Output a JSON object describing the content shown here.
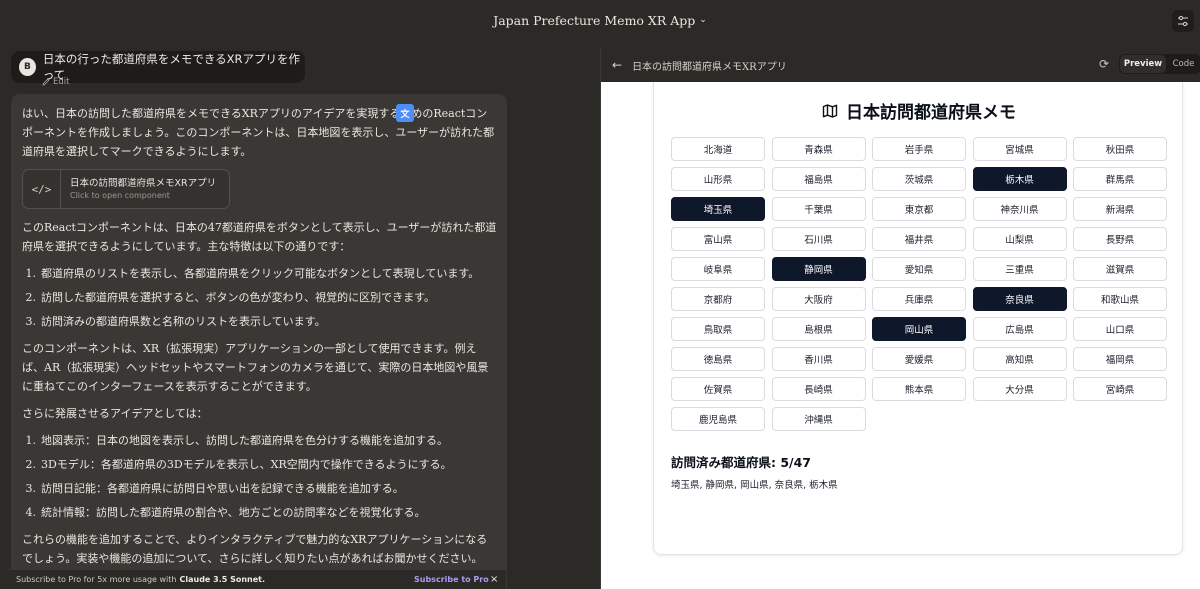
{
  "topbar": {
    "title": "Japan Prefecture Memo XR App",
    "chevron": "⌄"
  },
  "chat": {
    "user": {
      "initial": "B",
      "message": "日本の行った都道府県をメモできるXRアプリを作って",
      "edit_label": "Edit"
    },
    "assistant": {
      "intro": "はい、日本の訪問した都道府県をメモできるXRアプリのアイデアを実現するためのReactコンポーネントを作成しましょう。このコンポーネントは、日本地図を表示し、ユーザーが訪れた都道府県を選択してマークできるようにします。",
      "artifact": {
        "title": "日本の訪問都道府県メモXRアプリ",
        "subtitle": "Click to open component"
      },
      "para2": "このReactコンポーネントは、日本の47都道府県をボタンとして表示し、ユーザーが訪れた都道府県を選択できるようにしています。主な特徴は以下の通りです：",
      "features": [
        {
          "num": "1.",
          "text": "都道府県のリストを表示し、各都道府県をクリック可能なボタンとして表現しています。"
        },
        {
          "num": "2.",
          "text": "訪問した都道府県を選択すると、ボタンの色が変わり、視覚的に区別できます。"
        },
        {
          "num": "3.",
          "text": "訪問済みの都道府県数と名称のリストを表示しています。"
        }
      ],
      "para3": "このコンポーネントは、XR（拡張現実）アプリケーションの一部として使用できます。例えば、AR（拡張現実）ヘッドセットやスマートフォンのカメラを通じて、実際の日本地図や風景に重ねてこのインターフェースを表示することができます。",
      "para4": "さらに発展させるアイデアとしては：",
      "ideas": [
        {
          "num": "1.",
          "text": "地図表示：日本の地図を表示し、訪問した都道府県を色分けする機能を追加する。"
        },
        {
          "num": "2.",
          "text": "3Dモデル：各都道府県の3Dモデルを表示し、XR空間内で操作できるようにする。"
        },
        {
          "num": "3.",
          "text": "訪問日記能：各都道府県に訪問日や思い出を記録できる機能を追加する。"
        },
        {
          "num": "4.",
          "text": "統計情報：訪問した都道府県の割合や、地方ごとの訪問率などを視覚化する。"
        }
      ],
      "para5": "これらの機能を追加することで、よりインタラクティブで魅力的なXRアプリケーションになるでしょう。実装や機能の追加について、さらに詳しく知りたい点があればお聞かせください。"
    },
    "promo": {
      "text": "Subscribe to Pro for 5x more usage with",
      "model": "Claude 3.5 Sonnet.",
      "link": "Subscribe to Pro",
      "close": "×"
    }
  },
  "panel": {
    "title": "日本の訪問都道府県メモXRアプリ",
    "preview_label": "Preview",
    "code_label": "Code"
  },
  "app": {
    "title": "日本訪問都道府県メモ",
    "prefectures": [
      {
        "name": "北海道",
        "visited": false
      },
      {
        "name": "青森県",
        "visited": false
      },
      {
        "name": "岩手県",
        "visited": false
      },
      {
        "name": "宮城県",
        "visited": false
      },
      {
        "name": "秋田県",
        "visited": false
      },
      {
        "name": "山形県",
        "visited": false
      },
      {
        "name": "福島県",
        "visited": false
      },
      {
        "name": "茨城県",
        "visited": false
      },
      {
        "name": "栃木県",
        "visited": true
      },
      {
        "name": "群馬県",
        "visited": false
      },
      {
        "name": "埼玉県",
        "visited": true
      },
      {
        "name": "千葉県",
        "visited": false
      },
      {
        "name": "東京都",
        "visited": false
      },
      {
        "name": "神奈川県",
        "visited": false
      },
      {
        "name": "新潟県",
        "visited": false
      },
      {
        "name": "富山県",
        "visited": false
      },
      {
        "name": "石川県",
        "visited": false
      },
      {
        "name": "福井県",
        "visited": false
      },
      {
        "name": "山梨県",
        "visited": false
      },
      {
        "name": "長野県",
        "visited": false
      },
      {
        "name": "岐阜県",
        "visited": false
      },
      {
        "name": "静岡県",
        "visited": true
      },
      {
        "name": "愛知県",
        "visited": false
      },
      {
        "name": "三重県",
        "visited": false
      },
      {
        "name": "滋賀県",
        "visited": false
      },
      {
        "name": "京都府",
        "visited": false
      },
      {
        "name": "大阪府",
        "visited": false
      },
      {
        "name": "兵庫県",
        "visited": false
      },
      {
        "name": "奈良県",
        "visited": true
      },
      {
        "name": "和歌山県",
        "visited": false
      },
      {
        "name": "鳥取県",
        "visited": false
      },
      {
        "name": "島根県",
        "visited": false
      },
      {
        "name": "岡山県",
        "visited": true
      },
      {
        "name": "広島県",
        "visited": false
      },
      {
        "name": "山口県",
        "visited": false
      },
      {
        "name": "徳島県",
        "visited": false
      },
      {
        "name": "香川県",
        "visited": false
      },
      {
        "name": "愛媛県",
        "visited": false
      },
      {
        "name": "高知県",
        "visited": false
      },
      {
        "name": "福岡県",
        "visited": false
      },
      {
        "name": "佐賀県",
        "visited": false
      },
      {
        "name": "長崎県",
        "visited": false
      },
      {
        "name": "熊本県",
        "visited": false
      },
      {
        "name": "大分県",
        "visited": false
      },
      {
        "name": "宮崎県",
        "visited": false
      },
      {
        "name": "鹿児島県",
        "visited": false
      },
      {
        "name": "沖縄県",
        "visited": false
      }
    ],
    "visited_heading": "訪問済み都道府県: 5/47",
    "visited_list": "埼玉県, 静岡県, 岡山県, 奈良県, 栃木県"
  },
  "colors": {
    "selected_bg": "#0f172a",
    "promo_link": "#a99cf2",
    "chat_bg": "#2b2a27"
  }
}
